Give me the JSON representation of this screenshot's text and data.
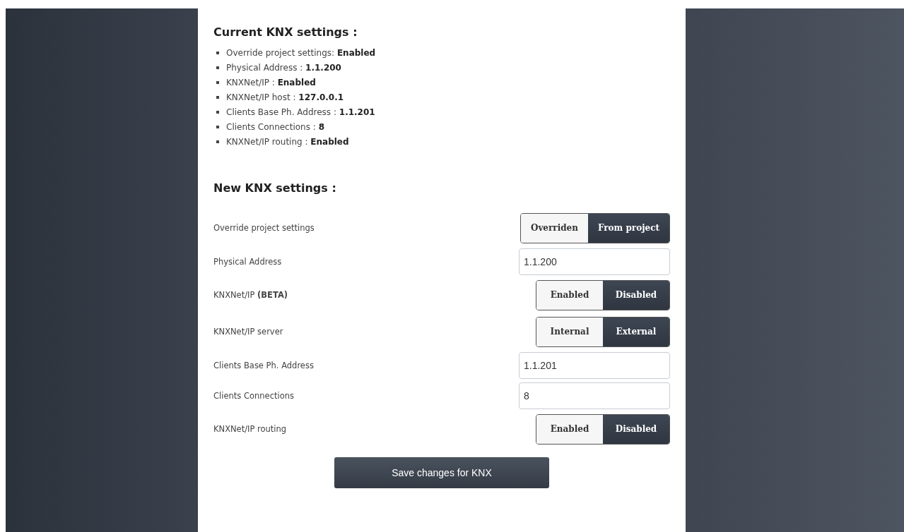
{
  "current": {
    "title": "Current KNX settings :",
    "items": [
      "Override project settings: **Enabled**",
      "Physical Address : **1.1.200**",
      "KNXNet/IP : **Enabled**",
      "KNXNet/IP host : **127.0.0.1**",
      "Clients Base Ph. Address : **1.1.201**",
      "Clients Connections : **8**",
      "KNXNet/IP routing : **Enabled**"
    ]
  },
  "new": {
    "title": "New KNX settings :",
    "rows": [
      {
        "kind": "toggle",
        "label": "Override project settings",
        "options": [
          {
            "label": "Overriden",
            "selected": false
          },
          {
            "label": "From project",
            "selected": true
          }
        ]
      },
      {
        "kind": "input",
        "label": "Physical Address",
        "value": "1.1.200"
      },
      {
        "kind": "toggle",
        "label": "KNXNet/IP **(BETA)**",
        "options": [
          {
            "label": "Enabled",
            "selected": false
          },
          {
            "label": "Disabled",
            "selected": true
          }
        ]
      },
      {
        "kind": "toggle",
        "label": "KNXNet/IP server",
        "options": [
          {
            "label": "Internal",
            "selected": false
          },
          {
            "label": "External",
            "selected": true
          }
        ]
      },
      {
        "kind": "input",
        "label": "Clients Base Ph. Address",
        "value": "1.1.201"
      },
      {
        "kind": "input",
        "label": "Clients Connections",
        "value": "8"
      },
      {
        "kind": "toggle",
        "label": "KNXNet/IP routing",
        "options": [
          {
            "label": "Enabled",
            "selected": false
          },
          {
            "label": "Disabled",
            "selected": true
          }
        ]
      }
    ],
    "save": "Save changes for KNX"
  }
}
